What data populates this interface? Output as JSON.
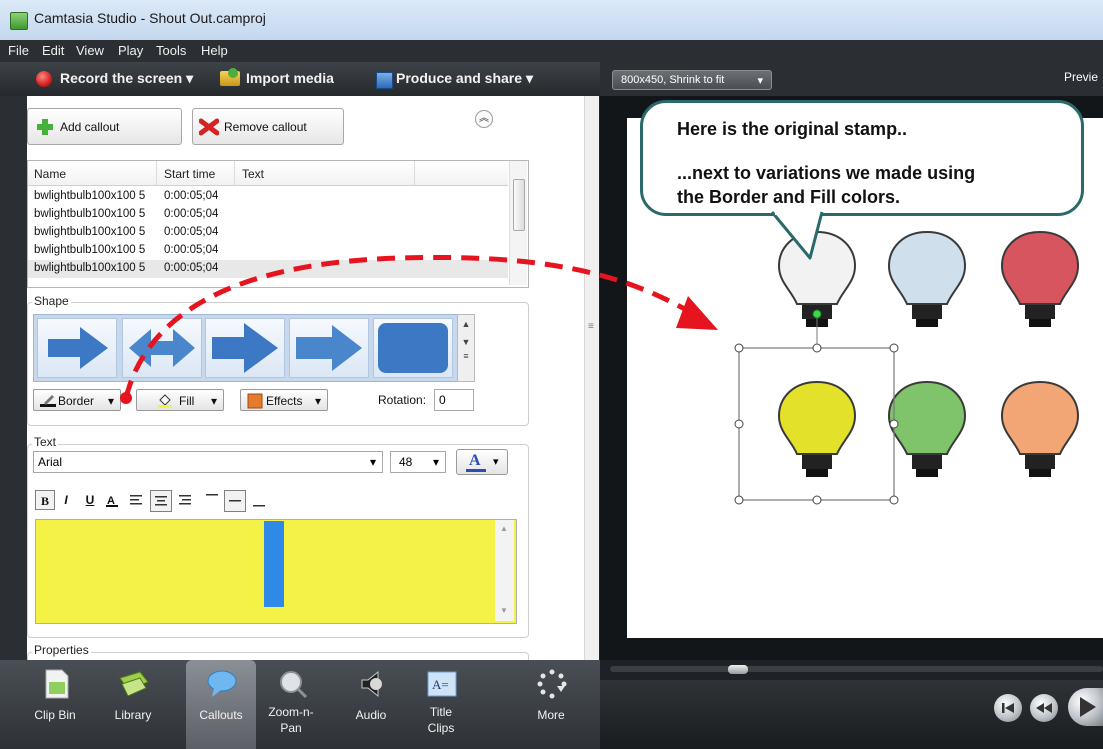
{
  "window": {
    "title": "Camtasia Studio - Shout Out.camproj"
  },
  "menu": [
    "File",
    "Edit",
    "View",
    "Play",
    "Tools",
    "Help"
  ],
  "tasks": {
    "record": "Record the screen",
    "import": "Import media",
    "produce": "Produce and share"
  },
  "callouts": {
    "add_label": "Add callout",
    "remove_label": "Remove callout",
    "table": {
      "columns": [
        "Name",
        "Start time",
        "Text"
      ],
      "rows": [
        {
          "name": "bwlightbulb100x100 5",
          "start": "0:00:05;04",
          "text": ""
        },
        {
          "name": "bwlightbulb100x100 5",
          "start": "0:00:05;04",
          "text": ""
        },
        {
          "name": "bwlightbulb100x100 5",
          "start": "0:00:05;04",
          "text": ""
        },
        {
          "name": "bwlightbulb100x100 5",
          "start": "0:00:05;04",
          "text": ""
        },
        {
          "name": "bwlightbulb100x100 5",
          "start": "0:00:05;04",
          "text": ""
        }
      ]
    }
  },
  "shape": {
    "group_label": "Shape",
    "border_label": "Border",
    "fill_label": "Fill",
    "effects_label": "Effects",
    "rotation_label": "Rotation:",
    "rotation_value": "0"
  },
  "text": {
    "group_label": "Text",
    "font": "Arial",
    "size": "48",
    "format_buttons": {
      "bold": "B",
      "italic": "I",
      "underline": "U"
    },
    "editor_color": "#f4f247"
  },
  "properties": {
    "group_label": "Properties"
  },
  "bottom_tabs": [
    {
      "label": "Clip Bin",
      "icon": "clip-bin-icon"
    },
    {
      "label": "Library",
      "icon": "library-icon"
    },
    {
      "label": "Callouts",
      "icon": "callout-icon",
      "active": true
    },
    {
      "label": "Zoom-n-\nPan",
      "icon": "magnifier-icon"
    },
    {
      "label": "Audio",
      "icon": "speaker-icon"
    },
    {
      "label": "Title\nClips",
      "icon": "title-clip-icon"
    },
    {
      "label": "More",
      "icon": "more-dots-icon"
    }
  ],
  "preview": {
    "zoom": "800x450, Shrink to fit",
    "label": "Previe",
    "callout_lines": [
      "Here is the original stamp..",
      "",
      "...next to variations we made using",
      "the Border and Fill colors."
    ],
    "bulb_colors": [
      "#f2f2f2",
      "#cfe0ec",
      "#d7555e",
      "#e4e12a",
      "#7fc46a",
      "#f2a675"
    ]
  }
}
